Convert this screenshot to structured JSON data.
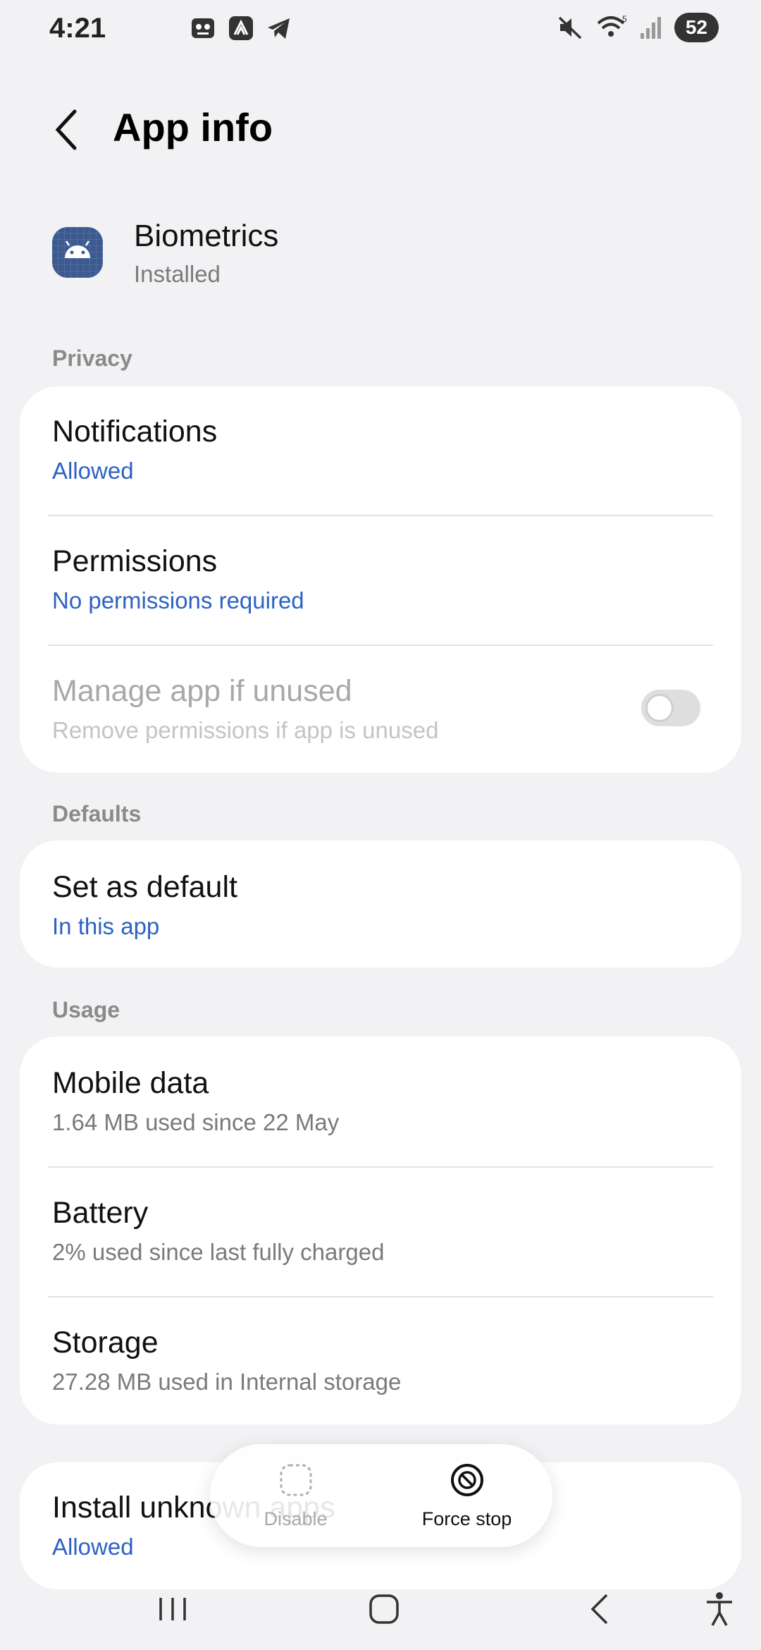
{
  "status_bar": {
    "time": "4:21",
    "battery": "52",
    "icons_left": [
      "game-icon",
      "app-icon",
      "telegram-icon"
    ],
    "icons_right": [
      "mute-icon",
      "wifi-icon",
      "signal-icon"
    ]
  },
  "header": {
    "title": "App info"
  },
  "app": {
    "name": "Biometrics",
    "status": "Installed"
  },
  "sections": {
    "privacy": "Privacy",
    "defaults": "Defaults",
    "usage": "Usage"
  },
  "privacy": {
    "notifications": {
      "title": "Notifications",
      "sub": "Allowed"
    },
    "permissions": {
      "title": "Permissions",
      "sub": "No permissions required"
    },
    "manage": {
      "title": "Manage app if unused",
      "sub": "Remove permissions if app is unused",
      "enabled": false
    }
  },
  "defaults": {
    "set_default": {
      "title": "Set as default",
      "sub": "In this app"
    }
  },
  "usage": {
    "mobile_data": {
      "title": "Mobile data",
      "sub": "1.64 MB used since 22 May"
    },
    "battery": {
      "title": "Battery",
      "sub": "2% used since last fully charged"
    },
    "storage": {
      "title": "Storage",
      "sub": "27.28 MB used in Internal storage"
    }
  },
  "install_unknown": {
    "title": "Install unknown apps",
    "sub": "Allowed"
  },
  "actions": {
    "disable": "Disable",
    "force_stop": "Force stop"
  },
  "colors": {
    "accent": "#2d62c4",
    "background": "#f2f2f4"
  }
}
